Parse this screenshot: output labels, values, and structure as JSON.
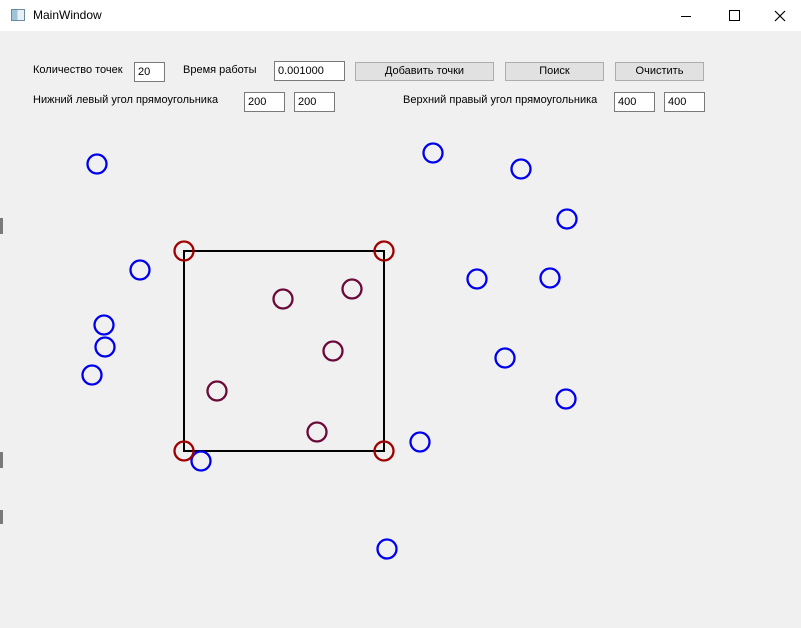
{
  "window": {
    "title": "MainWindow"
  },
  "controls": {
    "count_label": "Количество точек",
    "count_value": "20",
    "time_label": "Время работы",
    "time_value": "0.001000",
    "add_button": "Добавить точки",
    "search_button": "Поиск",
    "clear_button": "Очистить",
    "lower_left_label": "Нижний левый угол прямоугольника",
    "lower_left_x": "200",
    "lower_left_y": "200",
    "upper_right_label": "Верхний правый угол прямоугольника",
    "upper_right_x": "400",
    "upper_right_y": "400"
  },
  "colors": {
    "outside": "#0000ee",
    "inside": "#6b0a3a",
    "corner": "#a00000",
    "rect": "#000000"
  }
}
